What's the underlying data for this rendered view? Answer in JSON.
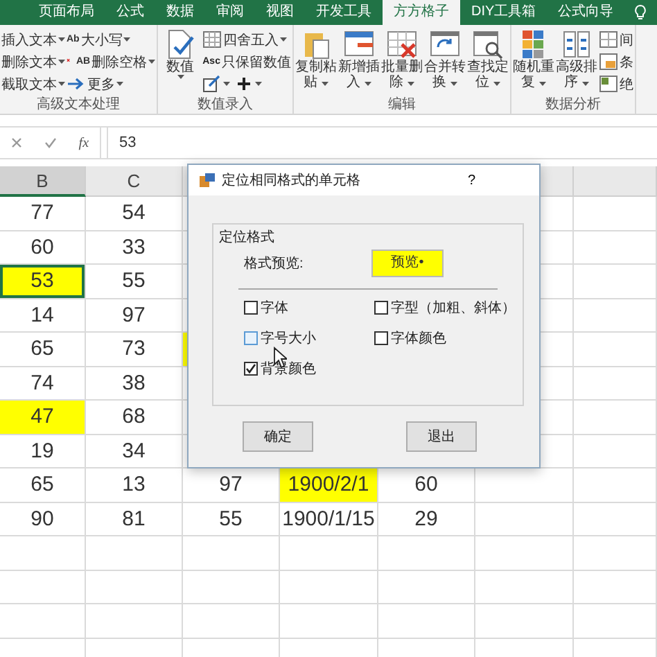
{
  "ribbon_tabs": [
    {
      "label": "页面布局",
      "selected": false
    },
    {
      "label": "公式",
      "selected": false
    },
    {
      "label": "数据",
      "selected": false
    },
    {
      "label": "审阅",
      "selected": false
    },
    {
      "label": "视图",
      "selected": false
    },
    {
      "label": "开发工具",
      "selected": false
    },
    {
      "label": "方方格子",
      "selected": true
    },
    {
      "label": "DIY工具箱",
      "selected": false
    },
    {
      "label": "公式向导",
      "selected": false
    }
  ],
  "ribbon_groups": [
    {
      "label": "高级文本处理",
      "columns": [
        {
          "kind": "stack",
          "rows": [
            [
              {
                "label": "插入文本",
                "dropdown": true
              }
            ],
            [
              {
                "label": "删除文本",
                "dropdown": true
              }
            ],
            [
              {
                "label": "截取文本",
                "dropdown": true
              }
            ]
          ]
        },
        {
          "kind": "stack",
          "rows": [
            [
              {
                "icon_text": "Ab",
                "label": "大小写",
                "dropdown": true
              }
            ],
            [
              {
                "icon_text": "AB",
                "label": "删除空格",
                "dropdown": true
              }
            ],
            [
              {
                "label": "更多",
                "dropdown": true
              }
            ]
          ]
        }
      ]
    },
    {
      "label": "数值录入",
      "columns": [
        {
          "kind": "large",
          "lines": [
            "数值"
          ],
          "dropdown": true
        },
        {
          "kind": "stack",
          "rows": [
            [
              {
                "label": "四舍五入",
                "dropdown": true
              }
            ],
            [
              {
                "icon_text": "Asc",
                "label": "只保留数值",
                "dropdown": false
              }
            ],
            [
              {
                "dropdown": true
              },
              {
                "dropdown": true
              }
            ]
          ]
        }
      ]
    },
    {
      "label": "编辑",
      "columns": [
        {
          "kind": "large",
          "lines": [
            "复制粘",
            "贴"
          ],
          "dropdown": true
        },
        {
          "kind": "large",
          "lines": [
            "新增插",
            "入"
          ],
          "dropdown": true
        },
        {
          "kind": "large",
          "lines": [
            "批量删",
            "除"
          ],
          "dropdown": true
        },
        {
          "kind": "large",
          "lines": [
            "合并转",
            "换"
          ],
          "dropdown": true
        },
        {
          "kind": "large",
          "lines": [
            "查找定",
            "位"
          ],
          "dropdown": true
        }
      ]
    },
    {
      "label": "数据分析",
      "columns": [
        {
          "kind": "large",
          "lines": [
            "随机重",
            "复"
          ],
          "dropdown": true
        },
        {
          "kind": "large",
          "lines": [
            "高级排",
            "序"
          ],
          "dropdown": true
        },
        {
          "kind": "stack",
          "rows": [
            [
              {
                "label": "间",
                "dropdown": false
              }
            ],
            [
              {
                "label": "条",
                "dropdown": false
              }
            ],
            [
              {
                "label": "绝",
                "dropdown": false
              }
            ]
          ]
        }
      ]
    }
  ],
  "formula_bar": {
    "function_label": "fx",
    "value": "53"
  },
  "sheet": {
    "columns": [
      {
        "label": "B",
        "selected": true
      },
      {
        "label": "C",
        "selected": false
      }
    ],
    "rows": [
      [
        {
          "text": "77",
          "highlighted": false,
          "selected": false
        },
        {
          "text": "54",
          "highlighted": false,
          "selected": false
        }
      ],
      [
        {
          "text": "60",
          "highlighted": false,
          "selected": false
        },
        {
          "text": "33",
          "highlighted": false,
          "selected": false
        }
      ],
      [
        {
          "text": "53",
          "highlighted": true,
          "selected": true
        },
        {
          "text": "55",
          "highlighted": false,
          "selected": false
        }
      ],
      [
        {
          "text": "14",
          "highlighted": false,
          "selected": false
        },
        {
          "text": "97",
          "highlighted": false,
          "selected": false
        }
      ],
      [
        {
          "text": "65",
          "highlighted": false,
          "selected": false
        },
        {
          "text": "73",
          "highlighted": false,
          "selected": false
        },
        {
          "highlighted": true,
          "selected": false
        }
      ],
      [
        {
          "text": "74",
          "highlighted": false,
          "selected": false
        },
        {
          "text": "38",
          "highlighted": false,
          "selected": false
        }
      ],
      [
        {
          "text": "47",
          "highlighted": true,
          "selected": false
        },
        {
          "text": "68",
          "highlighted": false,
          "selected": false
        }
      ],
      [
        {
          "text": "19",
          "highlighted": false,
          "selected": false
        },
        {
          "text": "34",
          "highlighted": false,
          "selected": false
        }
      ],
      [
        {
          "text": "65",
          "highlighted": false,
          "selected": false
        },
        {
          "text": "13",
          "highlighted": false,
          "selected": false
        },
        {
          "text": "97",
          "highlighted": false,
          "selected": false
        },
        {
          "text": "1900/2/1",
          "highlighted": true,
          "selected": false
        },
        {
          "text": "60",
          "highlighted": false,
          "selected": false
        }
      ],
      [
        {
          "text": "90",
          "highlighted": false,
          "selected": false
        },
        {
          "text": "81",
          "highlighted": false,
          "selected": false
        },
        {
          "text": "55",
          "highlighted": false,
          "selected": false
        },
        {
          "text": "1900/1/15",
          "highlighted": false,
          "selected": false
        },
        {
          "text": "29",
          "highlighted": false,
          "selected": false
        }
      ]
    ]
  },
  "dialog": {
    "title": "定位相同格式的单元格",
    "help": "?",
    "group_title": "定位格式",
    "preview_label": "格式预览:",
    "preview": "预览•",
    "options": [
      {
        "label": "字体",
        "checked": false,
        "hovered": false
      },
      {
        "label": "字型（加粗、斜体）",
        "checked": false,
        "hovered": false
      },
      {
        "label": "字号大小",
        "checked": false,
        "hovered": true
      },
      {
        "label": "字体颜色",
        "checked": false,
        "hovered": false
      },
      {
        "label": "背景颜色",
        "checked": true,
        "hovered": false
      }
    ],
    "buttons": [
      "确定",
      "退出"
    ]
  }
}
